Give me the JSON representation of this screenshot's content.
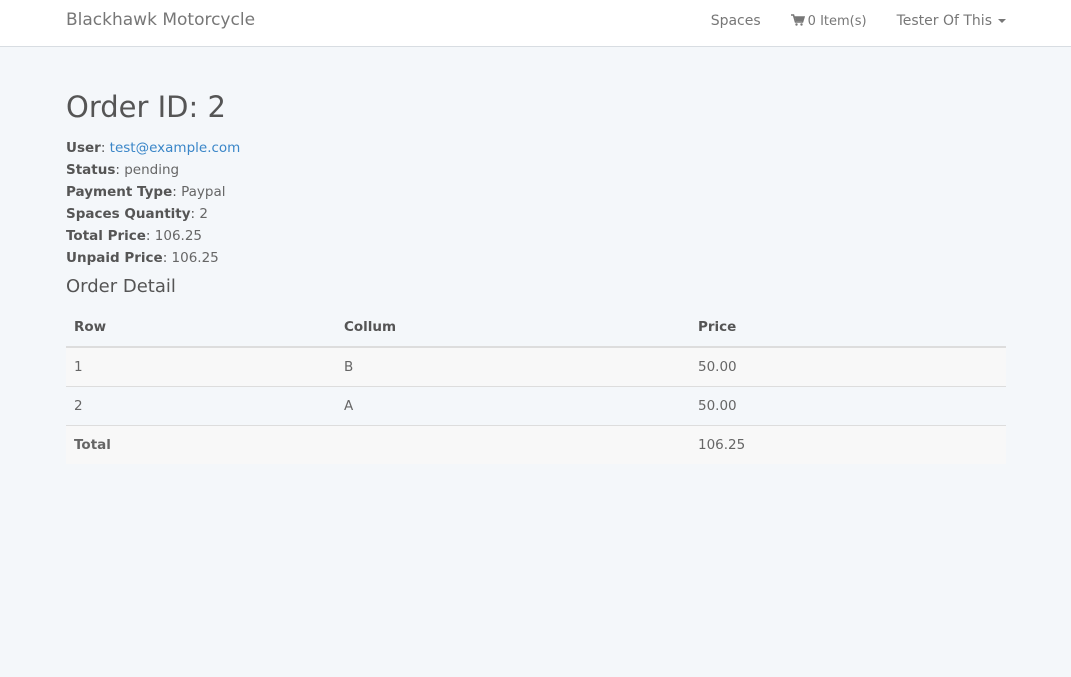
{
  "navbar": {
    "brand": "Blackhawk Motorcycle",
    "links": [
      {
        "label": "Spaces"
      },
      {
        "label": "0 Item(s)",
        "icon": "shopping-cart-icon"
      },
      {
        "label": "Tester Of This"
      }
    ]
  },
  "order": {
    "title": "Order ID: 2",
    "fields": [
      {
        "key": "User",
        "value": "test@example.com"
      },
      {
        "key": "Status",
        "value": "pending"
      },
      {
        "key": "Payment Type",
        "value": "Paypal"
      },
      {
        "key": "Spaces Quantity",
        "value": "2"
      },
      {
        "key": "Total Price",
        "value": "106.25"
      },
      {
        "key": "Unpaid Price",
        "value": "106.25"
      }
    ],
    "detail_title": "Order Detail",
    "table": {
      "headers": [
        "Row",
        "Collum",
        "Price"
      ],
      "rows": [
        [
          "1",
          "B",
          "50.00"
        ],
        [
          "2",
          "A",
          "50.00"
        ]
      ],
      "total_label": "Total",
      "total_value": "106.25"
    }
  },
  "colors": {
    "background": "#f4f7fa",
    "link": "#3a86c8",
    "navbar": "#ffffff"
  }
}
